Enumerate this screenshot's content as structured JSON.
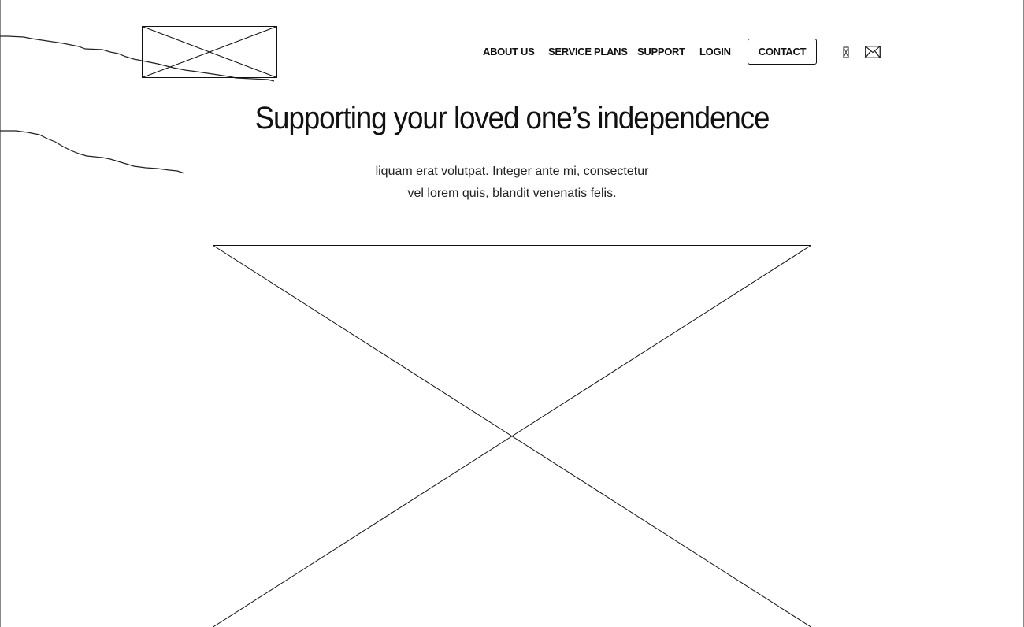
{
  "header": {
    "logo_icon": "image-placeholder-icon",
    "nav": {
      "about": "ABOUT US",
      "service_plans": "SERVICE PLANS",
      "support": "SUPPORT",
      "login": "LOGIN",
      "contact": "CONTACT"
    },
    "icons": {
      "phone": "phone-icon",
      "mail": "mail-icon"
    }
  },
  "hero": {
    "title": "Supporting your loved one’s independence",
    "subtitle_line1": "liquam erat volutpat. Integer ante mi, consectetur",
    "subtitle_line2": "vel lorem quis, blandit venenatis felis.",
    "image_icon": "image-placeholder-icon"
  },
  "colors": {
    "line": "#111111",
    "background": "#ffffff"
  }
}
